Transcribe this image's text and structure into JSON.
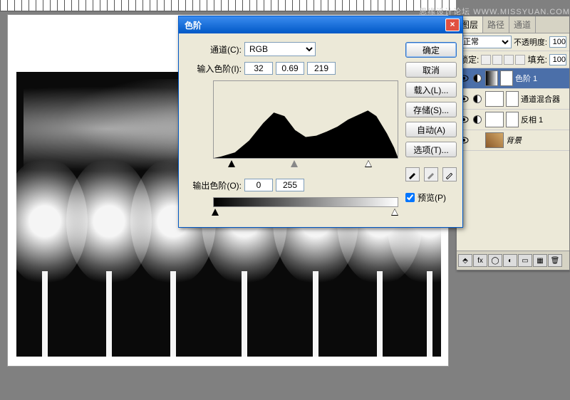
{
  "watermark": "思缘设计论坛  WWW.MISSYUAN.COM",
  "dialog": {
    "title": "色阶",
    "channel_label": "通道(C):",
    "channel_value": "RGB",
    "input_label": "输入色阶(I):",
    "input_black": "32",
    "input_gamma": "0.69",
    "input_white": "219",
    "output_label": "输出色阶(O):",
    "output_black": "0",
    "output_white": "255",
    "btn_ok": "确定",
    "btn_cancel": "取消",
    "btn_load": "载入(L)...",
    "btn_save": "存储(S)...",
    "btn_auto": "自动(A)",
    "btn_options": "选项(T)...",
    "preview_label": "预览(P)"
  },
  "panel": {
    "tabs": {
      "layers": "图层",
      "paths": "路径",
      "channels": "通道"
    },
    "blend_mode": "正常",
    "opacity_label": "不透明度:",
    "opacity_value": "100",
    "lock_label": "锁定:",
    "fill_label": "填充:",
    "fill_value": "100",
    "layers": [
      {
        "name": "色阶 1"
      },
      {
        "name": "通道混合器"
      },
      {
        "name": "反相 1"
      },
      {
        "name": "背景"
      }
    ]
  },
  "icons": {
    "close": "×",
    "link": "⬤",
    "fx": "fx",
    "adj": "◐",
    "folder": "▣",
    "new": "▦",
    "trash": "🗑"
  }
}
